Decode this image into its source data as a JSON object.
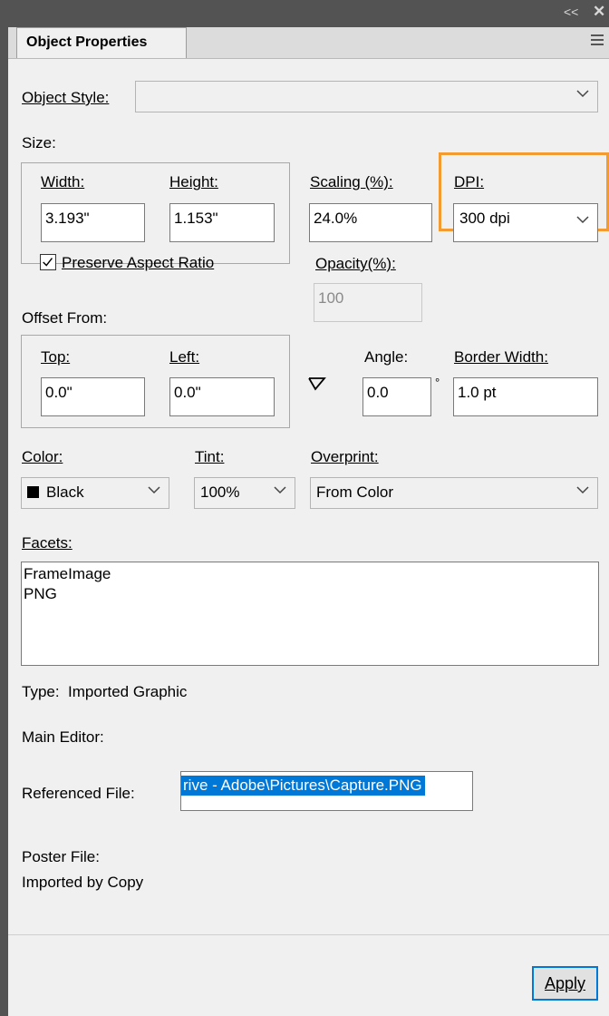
{
  "window": {
    "collapse_icon": "double-chevron-left-icon",
    "close_icon": "close-icon",
    "tab_label": "Object Properties",
    "menu_icon": "hamburger-menu-icon"
  },
  "object_style": {
    "label": "Object Style:",
    "value": ""
  },
  "size": {
    "section_label": "Size:",
    "width_label": "Width:",
    "width_value": "3.193\"",
    "height_label": "Height:",
    "height_value": "1.153\"",
    "preserve_label": "Preserve Aspect Ratio",
    "preserve_checked": true
  },
  "scaling": {
    "label": "Scaling (%):",
    "value": "24.0%"
  },
  "dpi": {
    "label": "DPI:",
    "value": "300 dpi",
    "highlight_color": "#f39b30"
  },
  "opacity": {
    "label": "Opacity(%):",
    "value": "100"
  },
  "offset": {
    "section_label": "Offset From:",
    "top_label": "Top:",
    "top_value": "0.0\"",
    "left_label": "Left:",
    "left_value": "0.0\""
  },
  "angle": {
    "icon": "angle-icon",
    "label": "Angle:",
    "value": "0.0",
    "degree_symbol": "°"
  },
  "border_width": {
    "label": "Border Width:",
    "value": "1.0 pt"
  },
  "color": {
    "label": "Color:",
    "value": "Black",
    "swatch": "#000000"
  },
  "tint": {
    "label": "Tint:",
    "value": "100%"
  },
  "overprint": {
    "label": "Overprint:",
    "value": "From Color"
  },
  "facets": {
    "label": "Facets:",
    "lines": [
      "FrameImage",
      "PNG"
    ]
  },
  "info": {
    "type_label": "Type:",
    "type_value": "Imported Graphic",
    "main_editor_label": "Main Editor:",
    "referenced_file_label": "Referenced File:",
    "referenced_file_value": "rive - Adobe\\Pictures\\Capture.PNG",
    "poster_file_label": "Poster File:",
    "imported_by": "Imported by Copy"
  },
  "apply_button": "Apply",
  "colors": {
    "accent": "#0078d7",
    "panel_chrome": "#535353"
  }
}
